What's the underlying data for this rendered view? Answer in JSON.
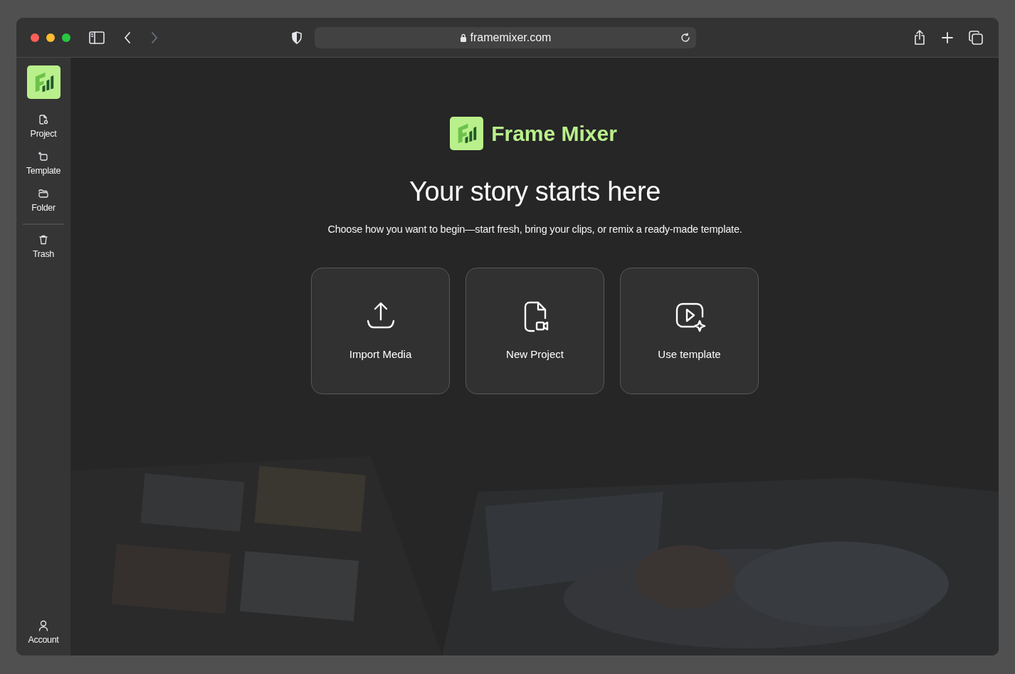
{
  "browser": {
    "url": "framemixer.com"
  },
  "sidebar": {
    "items": [
      {
        "label": "Project",
        "kind": "project"
      },
      {
        "label": "Template",
        "kind": "template"
      },
      {
        "label": "Folder",
        "kind": "folder"
      },
      {
        "label": "Trash",
        "kind": "trash"
      }
    ],
    "account": {
      "label": "Account"
    }
  },
  "hero": {
    "app_name": "Frame Mixer",
    "title": "Your story starts here",
    "subtitle": "Choose how you want to begin—start fresh, bring your clips, or remix a ready-made template."
  },
  "actions": [
    {
      "label": "Import Media",
      "kind": "import"
    },
    {
      "label": "New Project",
      "kind": "new"
    },
    {
      "label": "Use template",
      "kind": "template"
    }
  ]
}
